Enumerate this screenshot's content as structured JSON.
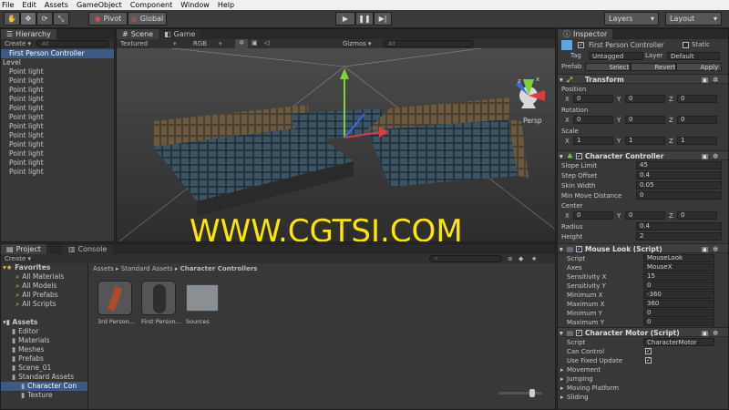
{
  "menu": [
    "File",
    "Edit",
    "Assets",
    "GameObject",
    "Component",
    "Window",
    "Help"
  ],
  "toolbar": {
    "pivot": "Pivot",
    "global": "Global",
    "layers": "Layers",
    "layout": "Layout"
  },
  "hierarchy": {
    "title": "Hierarchy",
    "create": "Create",
    "search": "All",
    "items": [
      "First Person Controller",
      "Level",
      "Point light",
      "Point light",
      "Point light",
      "Point light",
      "Point light",
      "Point light",
      "Point light",
      "Point light",
      "Point light",
      "Point light",
      "Point light",
      "Point light"
    ]
  },
  "scene": {
    "tab_scene": "Scene",
    "tab_game": "Game",
    "mode": "Textured",
    "channel": "RGB",
    "gizmos": "Gizmos",
    "search": "All",
    "persp": "Persp",
    "x_axis": "x",
    "z_axis": "z",
    "watermark": "WWW.CGTSJ.COM"
  },
  "project": {
    "tab_project": "Project",
    "tab_console": "Console",
    "create": "Create",
    "favorites": "Favorites",
    "fav_items": [
      "All Materials",
      "All Models",
      "All Prefabs",
      "All Scripts"
    ],
    "assets": "Assets",
    "asset_items": [
      "Editor",
      "Materials",
      "Meshes",
      "Prefabs",
      "Scene_01",
      "Standard Assets",
      "Character Con",
      "Texture"
    ],
    "breadcrumb": [
      "Assets",
      "Standard Assets",
      "Character Controllers"
    ],
    "grid": [
      "3rd Person...",
      "First Person...",
      "Sources"
    ]
  },
  "inspector": {
    "title": "Inspector",
    "object_name": "First Person Controller",
    "static": "Static",
    "tag_label": "Tag",
    "tag_value": "Untagged",
    "layer_label": "Layer",
    "layer_value": "Default",
    "prefab_label": "Prefab",
    "select": "Select",
    "revert": "Revert",
    "apply": "Apply",
    "transform": "Transform",
    "position": "Position",
    "rotation": "Rotation",
    "scale": "Scale",
    "pos": [
      "0",
      "0",
      "0"
    ],
    "rot": [
      "0",
      "0",
      "0"
    ],
    "scl": [
      "1",
      "1",
      "1"
    ],
    "x": "X",
    "y": "Y",
    "z": "Z",
    "cc": {
      "title": "Character Controller",
      "rows": [
        [
          "Slope Limit",
          "45"
        ],
        [
          "Step Offset",
          "0.4"
        ],
        [
          "Skin Width",
          "0.05"
        ],
        [
          "Min Move Distance",
          "0"
        ]
      ],
      "center": "Center",
      "center_vals": [
        "0",
        "0",
        "0"
      ],
      "radius_label": "Radius",
      "radius": "0.4",
      "height_label": "Height",
      "height": "2"
    },
    "ml": {
      "title": "Mouse Look (Script)",
      "rows": [
        [
          "Script",
          "MouseLook"
        ],
        [
          "Axes",
          "MouseX"
        ],
        [
          "Sensitivity X",
          "15"
        ],
        [
          "Sensitivity Y",
          "0"
        ],
        [
          "Minimum X",
          "-360"
        ],
        [
          "Maximum X",
          "360"
        ],
        [
          "Minimum Y",
          "0"
        ],
        [
          "Maximum Y",
          "0"
        ]
      ]
    },
    "cm": {
      "title": "Character Motor (Script)",
      "script_label": "Script",
      "script": "CharacterMotor",
      "can_control": "Can Control",
      "use_fixed": "Use Fixed Update",
      "folds": [
        "Movement",
        "Jumping",
        "Moving Platform",
        "Sliding"
      ]
    }
  }
}
